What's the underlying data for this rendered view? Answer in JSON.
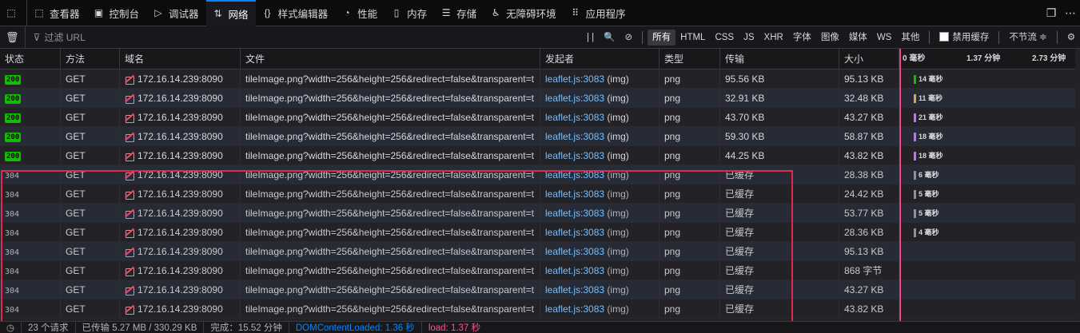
{
  "tabs": [
    {
      "name": "tab-inspector",
      "icon": "inspector-icon",
      "glyph": "⬚",
      "label": "查看器"
    },
    {
      "name": "tab-console",
      "icon": "console-icon",
      "glyph": "▣",
      "label": "控制台"
    },
    {
      "name": "tab-debugger",
      "icon": "debugger-icon",
      "glyph": "▷",
      "label": "调试器"
    },
    {
      "name": "tab-network",
      "icon": "network-icon",
      "glyph": "⇅",
      "label": "网络",
      "active": true
    },
    {
      "name": "tab-style-editor",
      "icon": "style-editor-icon",
      "glyph": "{}",
      "label": "样式编辑器"
    },
    {
      "name": "tab-performance",
      "icon": "performance-icon",
      "glyph": "◔",
      "label": "性能"
    },
    {
      "name": "tab-memory",
      "icon": "memory-icon",
      "glyph": "▯",
      "label": "内存"
    },
    {
      "name": "tab-storage",
      "icon": "storage-icon",
      "glyph": "☰",
      "label": "存储"
    },
    {
      "name": "tab-accessibility",
      "icon": "accessibility-icon",
      "glyph": "♿",
      "label": "无障碍环境"
    },
    {
      "name": "tab-application",
      "icon": "application-icon",
      "glyph": "⠿",
      "label": "应用程序"
    }
  ],
  "toolbar": {
    "filter_placeholder": "过滤 URL",
    "filter_types": [
      "所有",
      "HTML",
      "CSS",
      "JS",
      "XHR",
      "字体",
      "图像",
      "媒体",
      "WS",
      "其他"
    ],
    "disable_cache_label": "禁用缓存",
    "throttle_label": "不节流 ≑"
  },
  "columns": {
    "status": "状态",
    "method": "方法",
    "domain": "域名",
    "file": "文件",
    "initiator": "发起者",
    "type": "类型",
    "transferred": "传输",
    "size": "大小"
  },
  "timeline_ticks": [
    "0 毫秒",
    "1.37 分钟",
    "2.73 分钟"
  ],
  "requests": [
    {
      "status": "200",
      "method": "GET",
      "domain": "172.16.14.239:8090",
      "file": "tileImage.png?width=256&height=256&redirect=false&transparent=t",
      "initiator_link": "leaflet.js:3083",
      "initiator_type": "(img)",
      "type": "png",
      "transferred": "95.56 KB",
      "size": "95.13 KB",
      "timing": "14 毫秒",
      "timing_ms": 14,
      "bar_color": "#12bc00"
    },
    {
      "status": "200",
      "method": "GET",
      "domain": "172.16.14.239:8090",
      "file": "tileImage.png?width=256&height=256&redirect=false&transparent=t",
      "initiator_link": "leaflet.js:3083",
      "initiator_type": "(img)",
      "type": "png",
      "transferred": "32.91 KB",
      "size": "32.48 KB",
      "timing": "11 毫秒",
      "timing_ms": 11,
      "bar_color": "#d7a64a"
    },
    {
      "status": "200",
      "method": "GET",
      "domain": "172.16.14.239:8090",
      "file": "tileImage.png?width=256&height=256&redirect=false&transparent=t",
      "initiator_link": "leaflet.js:3083",
      "initiator_type": "(img)",
      "type": "png",
      "transferred": "43.70 KB",
      "size": "43.27 KB",
      "timing": "21 毫秒",
      "timing_ms": 21,
      "bar_color": "#c86aff"
    },
    {
      "status": "200",
      "method": "GET",
      "domain": "172.16.14.239:8090",
      "file": "tileImage.png?width=256&height=256&redirect=false&transparent=t",
      "initiator_link": "leaflet.js:3083",
      "initiator_type": "(img)",
      "type": "png",
      "transferred": "59.30 KB",
      "size": "58.87 KB",
      "timing": "18 毫秒",
      "timing_ms": 18,
      "bar_color": "#c86aff"
    },
    {
      "status": "200",
      "method": "GET",
      "domain": "172.16.14.239:8090",
      "file": "tileImage.png?width=256&height=256&redirect=false&transparent=t",
      "initiator_link": "leaflet.js:3083",
      "initiator_type": "(img)",
      "type": "png",
      "transferred": "44.25 KB",
      "size": "43.82 KB",
      "timing": "18 毫秒",
      "timing_ms": 18,
      "bar_color": "#c86aff"
    },
    {
      "status": "304",
      "method": "GET",
      "domain": "172.16.14.239:8090",
      "file": "tileImage.png?width=256&height=256&redirect=false&transparent=t",
      "initiator_link": "leaflet.js:3083",
      "initiator_type": "(img)",
      "type": "png",
      "transferred": "已缓存",
      "size": "28.38 KB",
      "timing": "6 毫秒",
      "timing_ms": 6,
      "bar_color": "#8f8f9d"
    },
    {
      "status": "304",
      "method": "GET",
      "domain": "172.16.14.239:8090",
      "file": "tileImage.png?width=256&height=256&redirect=false&transparent=t",
      "initiator_link": "leaflet.js:3083",
      "initiator_type": "(img)",
      "type": "png",
      "transferred": "已缓存",
      "size": "24.42 KB",
      "timing": "5 毫秒",
      "timing_ms": 5,
      "bar_color": "#8f8f9d"
    },
    {
      "status": "304",
      "method": "GET",
      "domain": "172.16.14.239:8090",
      "file": "tileImage.png?width=256&height=256&redirect=false&transparent=t",
      "initiator_link": "leaflet.js:3083",
      "initiator_type": "(img)",
      "type": "png",
      "transferred": "已缓存",
      "size": "53.77 KB",
      "timing": "5 毫秒",
      "timing_ms": 5,
      "bar_color": "#8f8f9d"
    },
    {
      "status": "304",
      "method": "GET",
      "domain": "172.16.14.239:8090",
      "file": "tileImage.png?width=256&height=256&redirect=false&transparent=t",
      "initiator_link": "leaflet.js:3083",
      "initiator_type": "(img)",
      "type": "png",
      "transferred": "已缓存",
      "size": "28.36 KB",
      "timing": "4 毫秒",
      "timing_ms": 4,
      "bar_color": "#8f8f9d"
    },
    {
      "status": "304",
      "method": "GET",
      "domain": "172.16.14.239:8090",
      "file": "tileImage.png?width=256&height=256&redirect=false&transparent=t",
      "initiator_link": "leaflet.js:3083",
      "initiator_type": "(img)",
      "type": "png",
      "transferred": "已缓存",
      "size": "95.13 KB",
      "timing": "",
      "timing_ms": null,
      "bar_color": ""
    },
    {
      "status": "304",
      "method": "GET",
      "domain": "172.16.14.239:8090",
      "file": "tileImage.png?width=256&height=256&redirect=false&transparent=t",
      "initiator_link": "leaflet.js:3083",
      "initiator_type": "(img)",
      "type": "png",
      "transferred": "已缓存",
      "size": "868 字节",
      "timing": "",
      "timing_ms": null,
      "bar_color": ""
    },
    {
      "status": "304",
      "method": "GET",
      "domain": "172.16.14.239:8090",
      "file": "tileImage.png?width=256&height=256&redirect=false&transparent=t",
      "initiator_link": "leaflet.js:3083",
      "initiator_type": "(img)",
      "type": "png",
      "transferred": "已缓存",
      "size": "43.27 KB",
      "timing": "",
      "timing_ms": null,
      "bar_color": ""
    },
    {
      "status": "304",
      "method": "GET",
      "domain": "172.16.14.239:8090",
      "file": "tileImage.png?width=256&height=256&redirect=false&transparent=t",
      "initiator_link": "leaflet.js:3083",
      "initiator_type": "(img)",
      "type": "png",
      "transferred": "已缓存",
      "size": "43.82 KB",
      "timing": "",
      "timing_ms": null,
      "bar_color": ""
    }
  ],
  "statusbar": {
    "requests": "23 个请求",
    "transferred": "已传输 5.27 MB / 330.29 KB",
    "finish": "完成：15.52 分钟",
    "dcl": "DOMContentLoaded: 1.36 秒",
    "load": "load: 1.37 秒"
  },
  "colors": {
    "accent": "#0a84ff",
    "status_ok": "#12bc00",
    "dcl": "#0a84ff",
    "load": "#ff4f9a",
    "highlight_box": "#e22850"
  }
}
